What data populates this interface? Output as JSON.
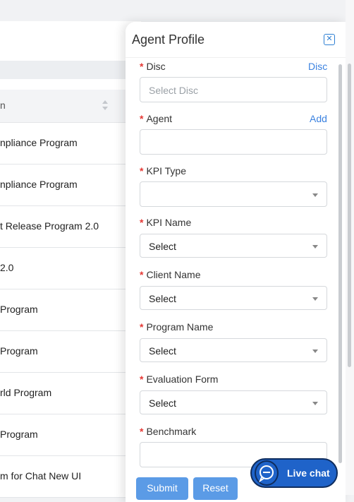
{
  "background": {
    "column_header": "n",
    "rows": [
      "npliance Program",
      "npliance Program",
      "t Release Program 2.0",
      "2.0",
      "Program",
      "Program",
      "rld Program",
      "Program",
      "m for Chat New UI"
    ]
  },
  "drawer": {
    "title": "Agent Profile",
    "fields": [
      {
        "label": "Disc",
        "link": "Disc",
        "value": "Select Disc",
        "type": "input-placeholder"
      },
      {
        "label": "Agent",
        "link": "Add",
        "value": "",
        "type": "input"
      },
      {
        "label": "KPI Type",
        "value": "",
        "type": "select"
      },
      {
        "label": "KPI Name",
        "value": "Select",
        "type": "select"
      },
      {
        "label": "Client Name",
        "value": "Select",
        "type": "select"
      },
      {
        "label": "Program Name",
        "value": "Select",
        "type": "select"
      },
      {
        "label": "Evaluation Form",
        "value": "Select",
        "type": "select"
      },
      {
        "label": "Benchmark",
        "value": "",
        "type": "input"
      }
    ],
    "required_mark": "*",
    "submit_label": "Submit",
    "reset_label": "Reset"
  },
  "live_chat": {
    "label": "Live chat"
  },
  "colors": {
    "accent": "#3b82e0",
    "required": "#e53935",
    "button": "#5b9be6",
    "livechat": "#1f63c9"
  }
}
